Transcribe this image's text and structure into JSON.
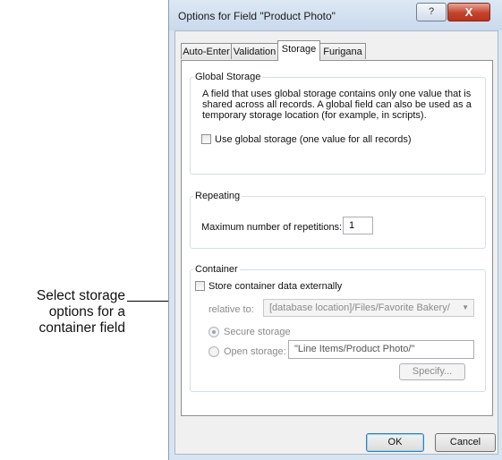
{
  "callout": {
    "lines": [
      "Select storage",
      "options for a",
      "container field"
    ]
  },
  "window": {
    "title": "Options for Field \"Product Photo\"",
    "help_label": "?",
    "close_label": "X"
  },
  "tabs": [
    "Auto-Enter",
    "Validation",
    "Storage",
    "Furigana"
  ],
  "active_tab": "Storage",
  "global_storage": {
    "legend": "Global Storage",
    "description": [
      "A field that uses global storage contains only one value that is",
      "shared across all records.  A global field can also be used as a",
      "temporary storage location (for example, in scripts)."
    ],
    "checkbox_label": "Use global storage (one value for all records)",
    "checked": false
  },
  "repeating": {
    "legend": "Repeating",
    "label": "Maximum number of repetitions:",
    "value": "1"
  },
  "container": {
    "legend": "Container",
    "store_externally_label": "Store container data externally",
    "store_externally_checked": false,
    "relative_to_label": "relative to:",
    "relative_to_value": "[database location]/Files/Favorite Bakery/",
    "secure_label": "Secure storage",
    "open_label": "Open storage:",
    "open_path": "\"Line Items/Product Photo/\"",
    "specify_label": "Specify..."
  },
  "footer": {
    "ok_label": "OK",
    "cancel_label": "Cancel"
  }
}
